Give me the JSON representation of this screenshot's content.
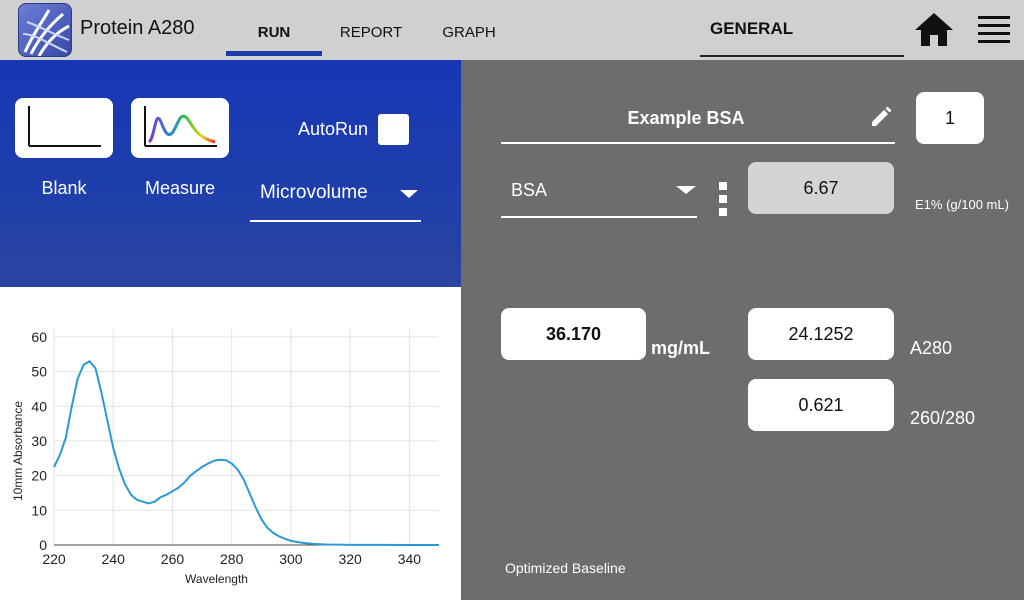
{
  "header": {
    "app_title": "Protein A280",
    "tabs": [
      "RUN",
      "REPORT",
      "GRAPH"
    ],
    "active_tab": "RUN",
    "method_group": "GENERAL",
    "icons": [
      "app-logo-icon",
      "home-icon",
      "hamburger-menu-icon"
    ]
  },
  "run_panel": {
    "blank_label": "Blank",
    "measure_label": "Measure",
    "autorun_label": "AutoRun",
    "autorun_checked": false,
    "mode_value": "Microvolume"
  },
  "results": {
    "sample_name": "Example BSA",
    "sample_count": "1",
    "protein_type": "BSA",
    "e1_value": "6.67",
    "e1_label": "E1% (g/100 mL)",
    "concentration": "36.170",
    "concentration_unit": "mg/mL",
    "a280_value": "24.1252",
    "a280_label": "A280",
    "ratio_value": "0.621",
    "ratio_label": "260/280",
    "baseline_label": "Optimized Baseline"
  },
  "colors": {
    "accent_blue": "#1736b6",
    "trace_blue": "#2a9ad6",
    "panel_gray": "#6d6d6d",
    "topbar_gray": "#d0d0d0"
  },
  "chart_data": {
    "type": "line",
    "xlabel": "Wavelength",
    "ylabel": "10mm Absorbance",
    "xlim": [
      220,
      350
    ],
    "ylim": [
      0,
      60
    ],
    "x_ticks": [
      220,
      240,
      260,
      280,
      300,
      320,
      340
    ],
    "y_ticks": [
      0,
      10,
      20,
      30,
      40,
      50,
      60
    ],
    "grid": true,
    "series": [
      {
        "x": [
          220,
          222,
          224,
          226,
          228,
          230,
          232,
          234,
          236,
          238,
          240,
          242,
          244,
          246,
          248,
          250,
          252,
          254,
          256,
          258,
          260,
          262,
          264,
          266,
          268,
          270,
          272,
          274,
          276,
          278,
          280,
          282,
          284,
          286,
          288,
          290,
          292,
          294,
          296,
          298,
          300,
          304,
          308,
          312,
          316,
          320,
          330,
          340,
          350
        ],
        "y": [
          22.5,
          26,
          31,
          40,
          48,
          52,
          53,
          51,
          44,
          36,
          28,
          22,
          17.5,
          14.5,
          13,
          12.5,
          12,
          12.5,
          13.8,
          14.5,
          15.5,
          16.5,
          18,
          20,
          21.3,
          22.5,
          23.5,
          24.3,
          24.6,
          24.5,
          23.5,
          21.8,
          19,
          15,
          11,
          7.5,
          5,
          3.5,
          2.5,
          1.8,
          1.2,
          0.6,
          0.3,
          0.15,
          0.1,
          0.05,
          0.02,
          0.01,
          0
        ]
      }
    ]
  }
}
